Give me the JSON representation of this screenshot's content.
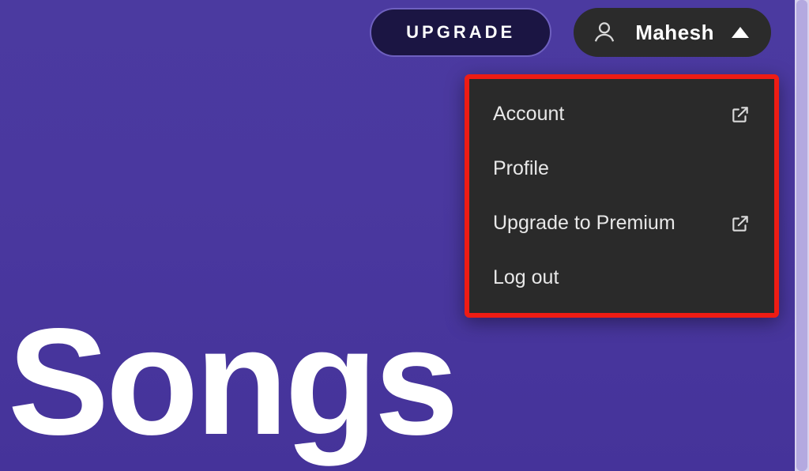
{
  "colors": {
    "background_gradient_top": "#4b3aa0",
    "background_gradient_bottom": "#45339a",
    "highlight_border": "#ee1c14",
    "chip_bg": "#2b2b2b",
    "menu_bg": "#2a2a2a",
    "upgrade_bg": "#1b1543",
    "upgrade_border": "#6e60bf",
    "text": "#ffffff"
  },
  "topbar": {
    "upgrade_label": "UPGRADE",
    "user": {
      "name": "Mahesh"
    }
  },
  "user_menu": {
    "items": [
      {
        "label": "Account",
        "external": true
      },
      {
        "label": "Profile",
        "external": false
      },
      {
        "label": "Upgrade to Premium",
        "external": true
      },
      {
        "label": "Log out",
        "external": false
      }
    ]
  },
  "page": {
    "title": "Songs"
  }
}
